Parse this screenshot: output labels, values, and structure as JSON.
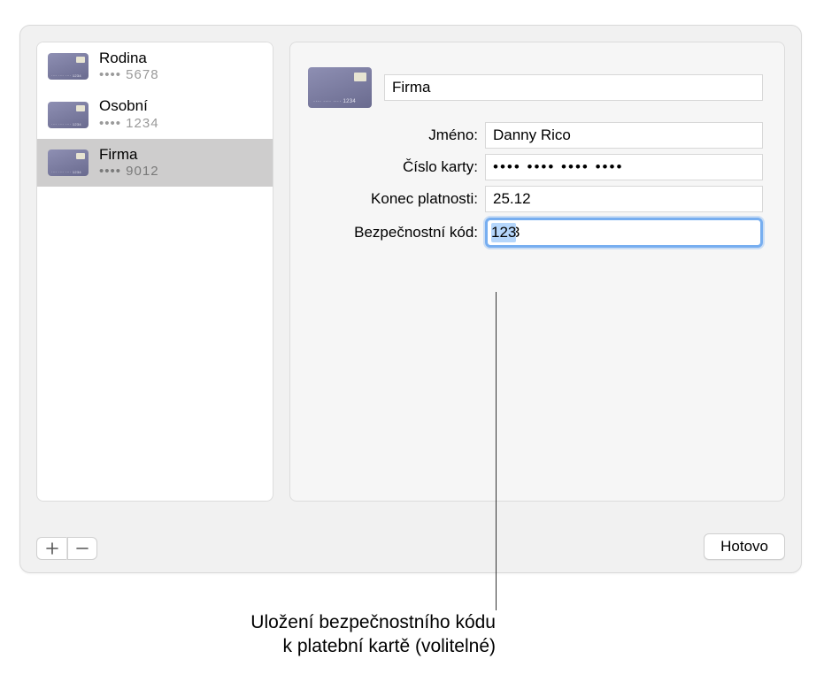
{
  "sidebar": {
    "items": [
      {
        "title": "Rodina",
        "sub": "•••• 5678"
      },
      {
        "title": "Osobní",
        "sub": "•••• 1234"
      },
      {
        "title": "Firma",
        "sub": "•••• 9012"
      }
    ]
  },
  "detail": {
    "card_name": "Firma",
    "labels": {
      "name": "Jméno:",
      "number": "Číslo karty:",
      "expiry": "Konec platnosti:",
      "security": "Bezpečnostní kód:"
    },
    "values": {
      "name": "Danny Rico",
      "number": "•••• •••• •••• ••••",
      "expiry": "25.12",
      "security": "123"
    }
  },
  "buttons": {
    "done": "Hotovo"
  },
  "callout": {
    "line1": "Uložení bezpečnostního kódu",
    "line2": "k platební kartě (volitelné)"
  }
}
